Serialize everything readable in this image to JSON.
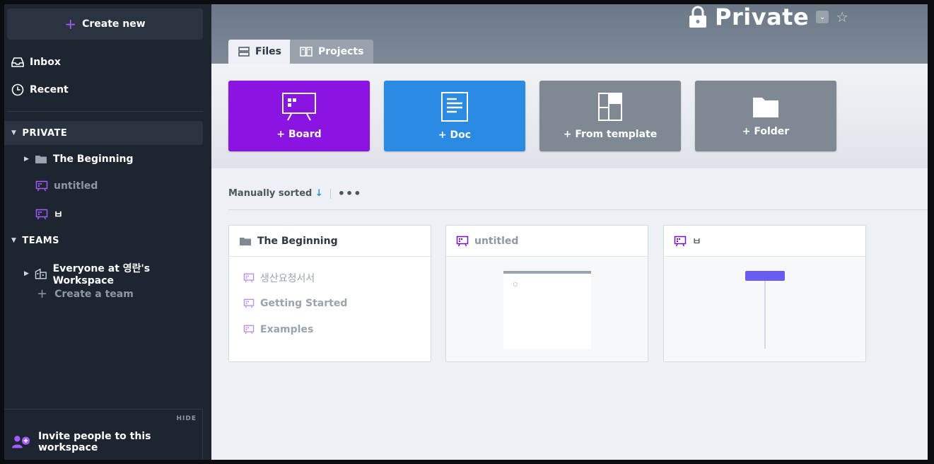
{
  "sidebar": {
    "create_new": "Create new",
    "inbox": "Inbox",
    "recent": "Recent",
    "private_header": "PRIVATE",
    "private_items": [
      {
        "label": "The Beginning",
        "icon": "folder-icon"
      },
      {
        "label": "untitled",
        "icon": "board-icon"
      },
      {
        "label": "ㅂ",
        "icon": "board-icon"
      }
    ],
    "teams_header": "TEAMS",
    "team_items": [
      {
        "label": "Everyone at 영란's Workspace",
        "icon": "building-icon"
      },
      {
        "label": "Create a team",
        "icon": "plus-icon"
      }
    ],
    "hide": "HIDE",
    "invite": "Invite people to this workspace"
  },
  "header": {
    "title": "Private",
    "tabs": [
      {
        "label": "Files",
        "active": true
      },
      {
        "label": "Projects",
        "active": false
      }
    ]
  },
  "quick_actions": [
    {
      "label": "+ Board",
      "color": "#8a14e0",
      "icon": "board-icon"
    },
    {
      "label": "+ Doc",
      "color": "#2b8ae2",
      "icon": "doc-icon"
    },
    {
      "label": "+ From template",
      "color": "#7e8994",
      "icon": "template-icon"
    },
    {
      "label": "+ Folder",
      "color": "#7e8994",
      "icon": "folder-icon"
    }
  ],
  "sort": {
    "label": "Manually sorted",
    "arrow": "↓",
    "more": "•••"
  },
  "files": [
    {
      "title": "The Beginning",
      "icon": "folder-icon",
      "children": [
        "생산요청서서",
        "Getting Started",
        "Examples"
      ]
    },
    {
      "title": "untitled",
      "icon": "board-icon"
    },
    {
      "title": "ㅂ",
      "icon": "board-icon"
    }
  ],
  "colors": {
    "accent_purple": "#8a14e0",
    "accent_blue": "#2b8ae2",
    "sidebar_bg": "#1c2530"
  }
}
